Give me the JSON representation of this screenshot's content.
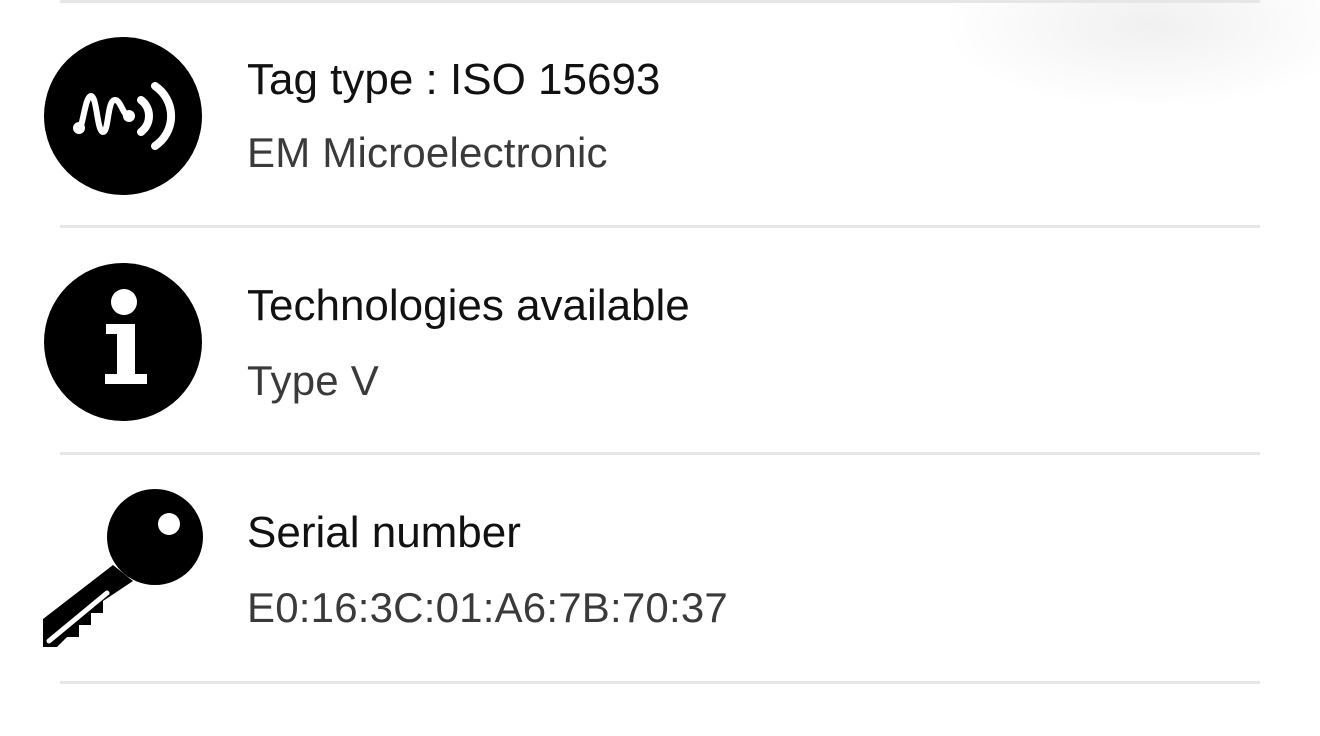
{
  "rows": [
    {
      "icon": "nfc-tag-icon",
      "title": "Tag type : ISO 15693",
      "value": "EM Microelectronic"
    },
    {
      "icon": "info-icon",
      "title": "Technologies available",
      "value": "Type V"
    },
    {
      "icon": "key-icon",
      "title": "Serial number",
      "value": "E0:16:3C:01:A6:7B:70:37"
    }
  ],
  "colors": {
    "icon": "#000000",
    "divider": "#e6e6e6",
    "title": "#111111",
    "value": "#3a3a3a"
  }
}
